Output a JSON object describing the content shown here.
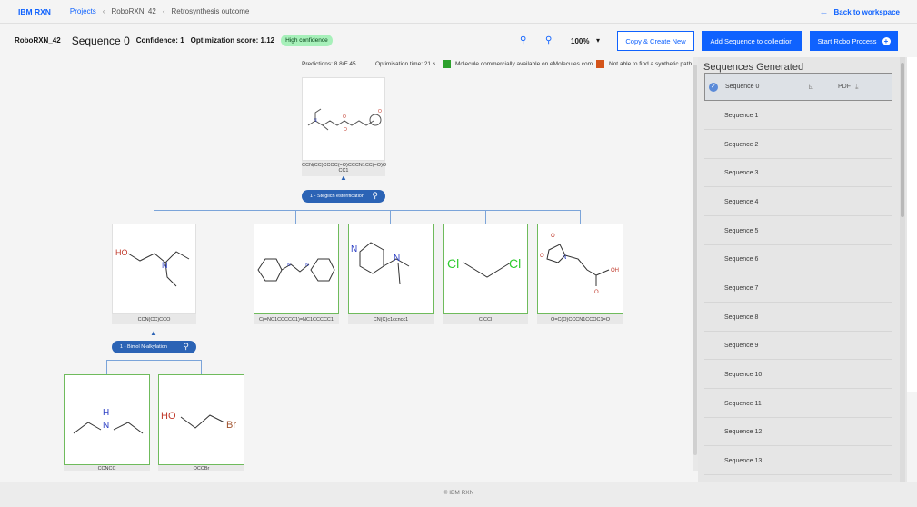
{
  "app": {
    "brand": "IBM RXN"
  },
  "breadcrumb": {
    "projects": "Projects",
    "project": "RoboRXN_42",
    "page": "Retrosynthesis outcome"
  },
  "nav": {
    "back": "Back to workspace"
  },
  "subbar": {
    "project": "RoboRXN_42",
    "sequence": "Sequence 0",
    "confidence": "Confidence: 1",
    "optimization": "Optimization score: 1.12",
    "badge": "High confidence"
  },
  "toolbar": {
    "zoom": "100%",
    "copy_create": "Copy & Create New",
    "add_to_collection": "Add Sequence to collection",
    "start_robo": "Start Robo Process"
  },
  "info": {
    "predictions": "Predictions: 8 8/F 45",
    "opt_time": "Optimisation time: 21 s",
    "legend_available": "Molecule commercially available on eMolecules.com",
    "legend_not_found": "Not able to find a synthetic path"
  },
  "colors": {
    "available": "#2ca02c",
    "not_found": "#d4541a",
    "accent": "#0f62fe"
  },
  "tree": {
    "root": {
      "smiles_line1": "CCN(CC)CCOC(=O)CCCN1CC(=O)O",
      "smiles_line2": "CC1"
    },
    "reaction1": "1 - Steglich esterification",
    "reactants1": [
      {
        "smiles": "CCN(CC)CCO"
      },
      {
        "smiles": "C(=NC1CCCCC1)=NC1CCCCC1"
      },
      {
        "smiles": "CN(C)c1ccncc1"
      },
      {
        "smiles": "ClCCl"
      },
      {
        "smiles": "O=C(O)CCCN1CCOC1=O"
      }
    ],
    "reaction2": "1 - Bimol N-alkylation",
    "reactants2": [
      {
        "smiles": "CCNCC"
      },
      {
        "smiles": "OCCBr"
      }
    ],
    "atoms": {
      "ho": "HO",
      "n": "N",
      "cl": "Cl",
      "oh": "OH",
      "h": "H",
      "br": "Br",
      "o": "O"
    }
  },
  "panel": {
    "title": "Sequences Generated",
    "pdf": "PDF",
    "items": [
      "Sequence 0",
      "Sequence 1",
      "Sequence 2",
      "Sequence 3",
      "Sequence 4",
      "Sequence 5",
      "Sequence 6",
      "Sequence 7",
      "Sequence 8",
      "Sequence 9",
      "Sequence 10",
      "Sequence 11",
      "Sequence 12",
      "Sequence 13"
    ]
  },
  "footer": {
    "text": "© IBM RXN"
  }
}
